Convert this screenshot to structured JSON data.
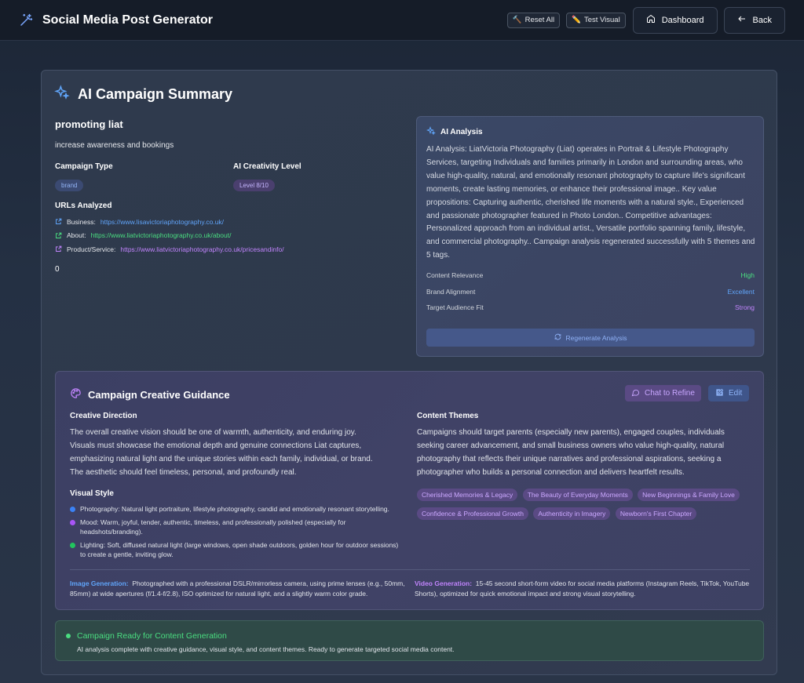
{
  "header": {
    "title": "Social Media Post Generator",
    "reset_label": "Reset All",
    "test_label": "Test Visual",
    "dashboard_label": "Dashboard",
    "back_label": "Back"
  },
  "summary": {
    "title": "AI Campaign Summary",
    "campaign_name": "promoting liat",
    "campaign_goal": "increase awareness and bookings",
    "campaign_type_label": "Campaign Type",
    "campaign_type": "brand",
    "creativity_label": "AI Creativity Level",
    "creativity_value": "Level 8/10",
    "urls_label": "URLs Analyzed",
    "urls": [
      {
        "label": "Business:",
        "url": "https://www.lisavictoriaphotography.co.uk/",
        "color": "#60a5fa"
      },
      {
        "label": "About:",
        "url": "https://www.liatvictoriaphotography.co.uk/about/",
        "color": "#4ade80"
      },
      {
        "label": "Product/Service:",
        "url": "https://www.liatvictoriaphotography.co.uk/pricesandinfo/",
        "color": "#c084fc"
      }
    ],
    "zero_value": "0"
  },
  "analysis": {
    "title": "AI Analysis",
    "text": "AI Analysis: LiatVictoria Photography (Liat) operates in Portrait & Lifestyle Photography Services, targeting Individuals and families primarily in London and surrounding areas, who value high-quality, natural, and emotionally resonant photography to capture life's significant moments, create lasting memories, or enhance their professional image.. Key value propositions: Capturing authentic, cherished life moments with a natural style., Experienced and passionate photographer featured in Photo London.. Competitive advantages: Personalized approach from an individual artist., Versatile portfolio spanning family, lifestyle, and commercial photography.. Campaign analysis regenerated successfully with 5 themes and 5 tags.",
    "metrics": [
      {
        "label": "Content Relevance",
        "value": "High",
        "color": "#4ade80"
      },
      {
        "label": "Brand Alignment",
        "value": "Excellent",
        "color": "#60a5fa"
      },
      {
        "label": "Target Audience Fit",
        "value": "Strong",
        "color": "#c084fc"
      }
    ],
    "regen_label": "Regenerate Analysis"
  },
  "guidance": {
    "title": "Campaign Creative Guidance",
    "chat_label": "Chat to Refine",
    "edit_label": "Edit",
    "creative_direction_label": "Creative Direction",
    "creative_direction": "The overall creative vision should be one of warmth, authenticity, and enduring joy. Visuals must showcase the emotional depth and genuine connections Liat captures, emphasizing natural light and the unique stories within each family, individual, or brand. The aesthetic should feel timeless, personal, and profoundly real.",
    "visual_style_label": "Visual Style",
    "visual_style": [
      {
        "text": "Photography: Natural light portraiture, lifestyle photography, candid and emotionally resonant storytelling.",
        "color": "#3b82f6"
      },
      {
        "text": "Mood: Warm, joyful, tender, authentic, timeless, and professionally polished (especially for headshots/branding).",
        "color": "#a855f7"
      },
      {
        "text": "Lighting: Soft, diffused natural light (large windows, open shade outdoors, golden hour for outdoor sessions) to create a gentle, inviting glow.",
        "color": "#22c55e"
      }
    ],
    "content_themes_label": "Content Themes",
    "content_themes": "Campaigns should target parents (especially new parents), engaged couples, individuals seeking career advancement, and small business owners who value high-quality, natural photography that reflects their unique narratives and professional aspirations, seeking a photographer who builds a personal connection and delivers heartfelt results.",
    "tags": [
      "Cherished Memories & Legacy",
      "The Beauty of Everyday Moments",
      "New Beginnings & Family Love",
      "Confidence & Professional Growth",
      "Authenticity in Imagery",
      "Newborn's First Chapter"
    ],
    "image_gen_label": "Image Generation:",
    "image_gen": "Photographed with a professional DSLR/mirrorless camera, using prime lenses (e.g., 50mm, 85mm) at wide apertures (f/1.4-f/2.8), ISO optimized for natural light, and a slightly warm color grade.",
    "video_gen_label": "Video Generation:",
    "video_gen": "15-45 second short-form video for social media platforms (Instagram Reels, TikTok, YouTube Shorts), optimized for quick emotional impact and strong visual storytelling."
  },
  "ready": {
    "title": "Campaign Ready for Content Generation",
    "subtitle": "AI analysis complete with creative guidance, visual style, and content themes. Ready to generate targeted social media content."
  }
}
